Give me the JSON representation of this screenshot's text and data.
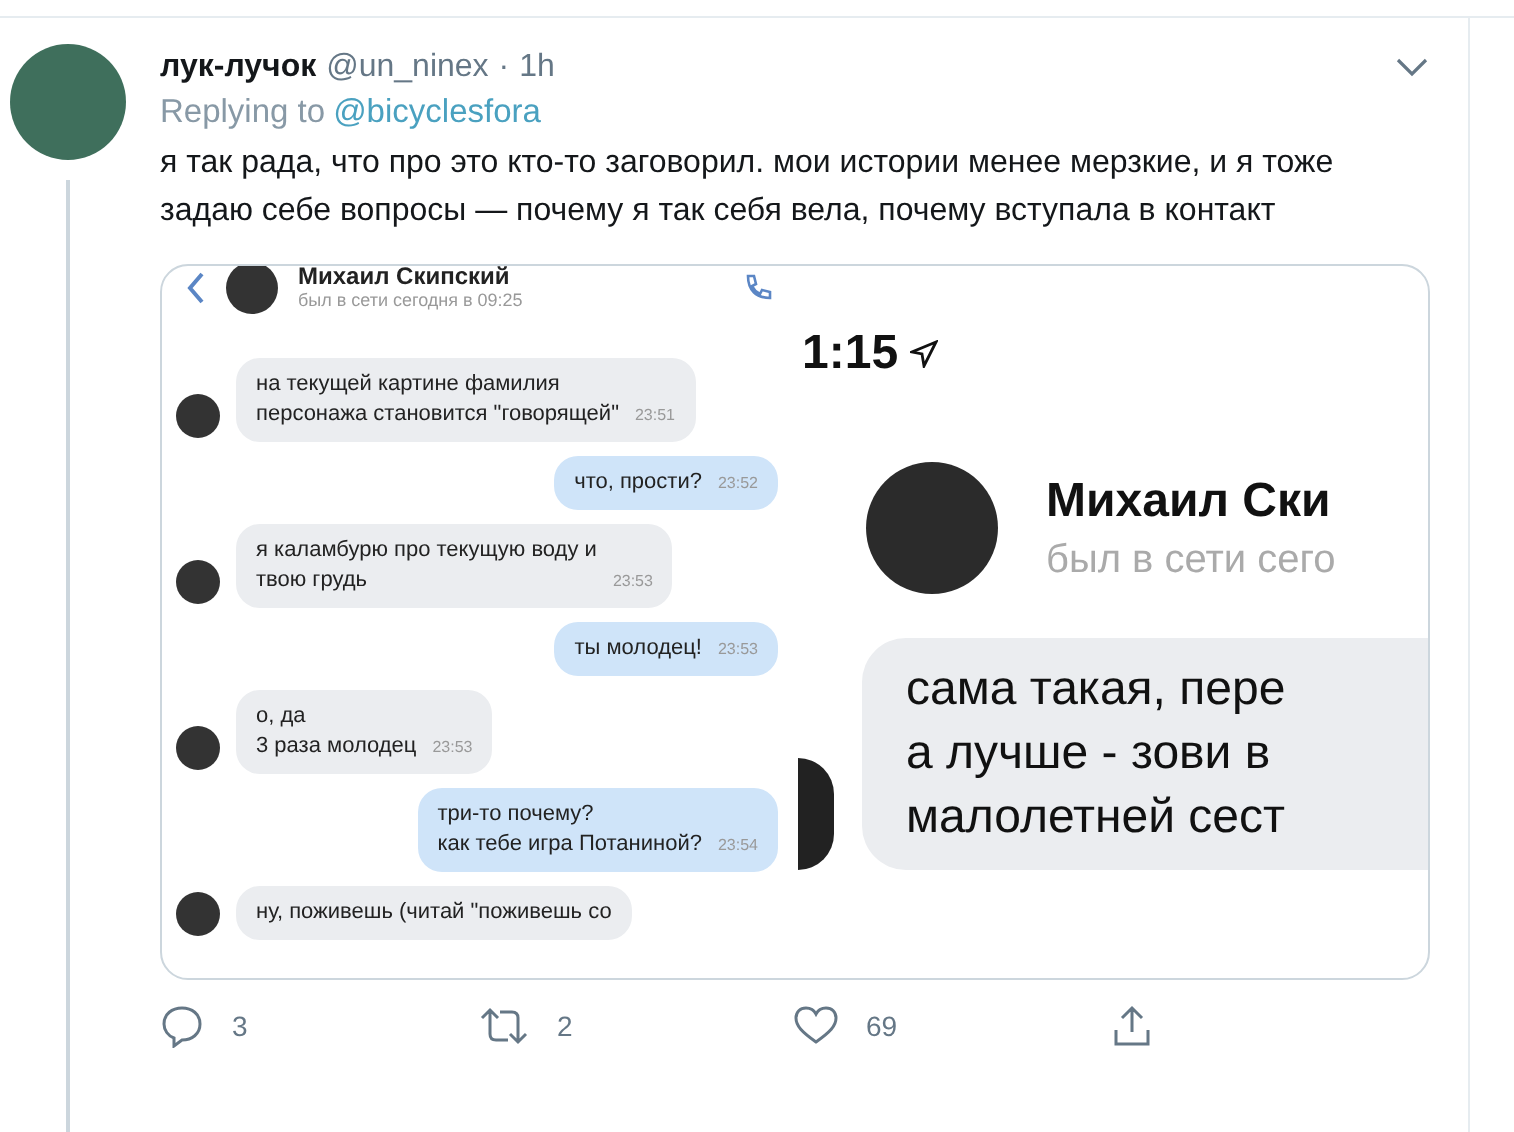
{
  "tweet": {
    "author": "лук-лучок",
    "handle": "@un_ninex",
    "separator": "·",
    "time": "1h",
    "replying_label": "Replying to",
    "replying_to": "@bicyclesfora",
    "text": "я так рада, что про это кто-то заговорил. мои истории менее мерзкие, и я тоже задаю себе вопросы — почему я так себя вела, почему вступала в контакт",
    "attachment": {
      "left_chat": {
        "contact_name": "Михаил Скипский",
        "status": "был в сети сегодня в 09:25",
        "messages": [
          {
            "kind": "received",
            "text": "на текущей картине фамилия\nперсонажа становится \"говорящей\"",
            "time": "23:51"
          },
          {
            "kind": "sent",
            "text": "что, прости?",
            "time": "23:52"
          },
          {
            "kind": "received",
            "text": "я каламбурю про текущую воду и\nтвою грудь",
            "time": "23:53"
          },
          {
            "kind": "sent",
            "text": "ты молодец!",
            "time": "23:53"
          },
          {
            "kind": "received",
            "text": "о, да\n3 раза молодец",
            "time": "23:53"
          },
          {
            "kind": "sent",
            "text": "три-то почему?\nкак тебе игра Потаниной?",
            "time": "23:54"
          },
          {
            "kind": "received",
            "text": "ну, поживешь (читай \"поживешь со"
          }
        ]
      },
      "right_chat": {
        "clock": "1:15",
        "contact_name": "Михаил Ски",
        "status": "был в сети сего",
        "message_lines": [
          "сама такая, пере",
          "а лучше - зови в",
          "малолетней сест"
        ]
      }
    },
    "actions": [
      {
        "kind": "reply",
        "count": "3"
      },
      {
        "kind": "retweet",
        "count": "2"
      },
      {
        "kind": "like",
        "count": "69"
      },
      {
        "kind": "share"
      }
    ]
  }
}
